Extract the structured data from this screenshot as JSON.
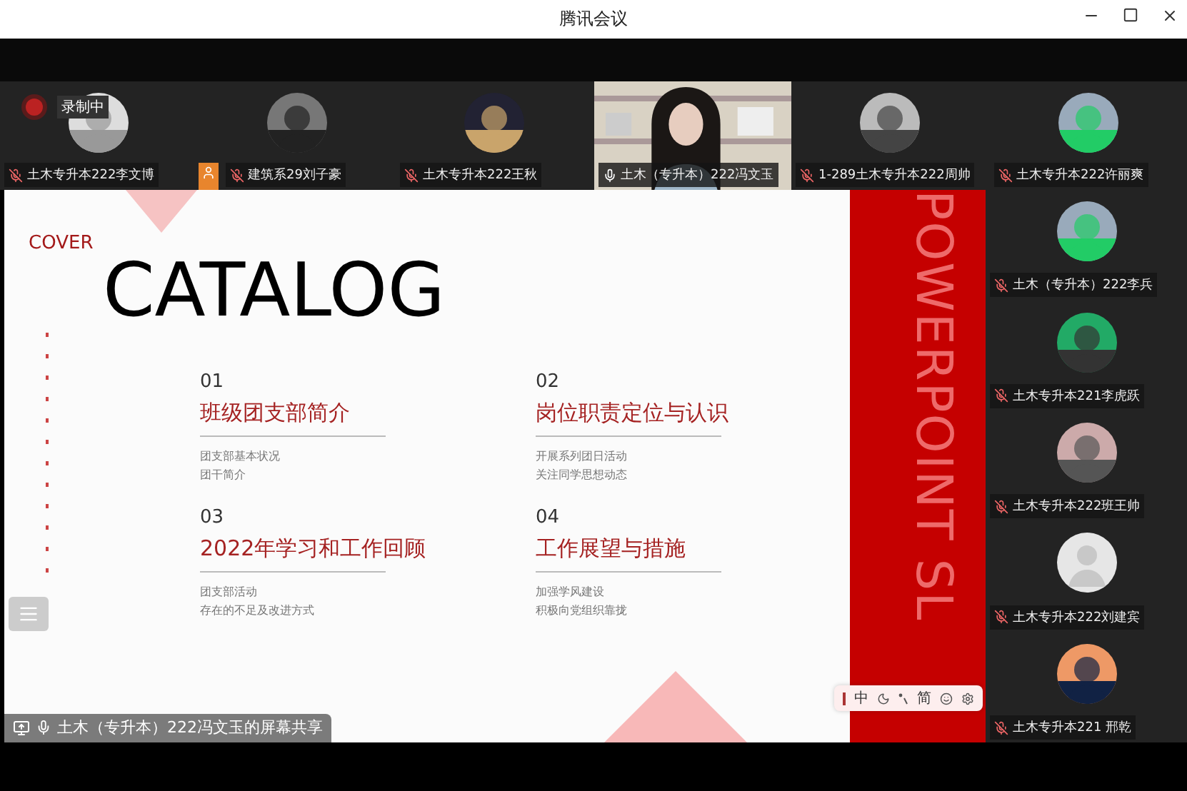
{
  "window": {
    "title": "腾讯会议"
  },
  "recording": {
    "label": "录制中"
  },
  "top_participants": [
    {
      "name": "土木专升本222李文博",
      "muted": true,
      "host": false
    },
    {
      "name": "建筑系29刘子豪",
      "muted": true,
      "host": true
    },
    {
      "name": "土木专升本222王秋",
      "muted": true,
      "host": false
    },
    {
      "name": "土木（专升本）222冯文玉",
      "kind": "video",
      "muted": false,
      "host": false
    },
    {
      "name": "1-289土木专升本222周帅",
      "muted": true,
      "host": false
    },
    {
      "name": "土木专升本222许丽爽",
      "muted": true,
      "host": false
    }
  ],
  "side_participants": [
    {
      "name": "土木（专升本）222李兵",
      "muted": true
    },
    {
      "name": "土木专升本221李虎跃",
      "muted": true
    },
    {
      "name": "土木专升本222班王帅",
      "muted": true
    },
    {
      "name": "土木专升本222刘建宾",
      "kind": "default",
      "muted": true
    },
    {
      "name": "土木专升本221 邢乾",
      "muted": true
    }
  ],
  "slide": {
    "kicker": "COVER",
    "title": "CATALOG",
    "band_text": "POWERPOINT SL",
    "sections": [
      {
        "number": "01",
        "heading": "班级团支部简介",
        "points": [
          "团支部基本状况",
          "团干简介"
        ]
      },
      {
        "number": "02",
        "heading": "岗位职责定位与认识",
        "points": [
          "开展系列团日活动",
          "关注同学思想动态"
        ]
      },
      {
        "number": "03",
        "heading": "2022年学习和工作回顾",
        "points": [
          "团支部活动",
          "存在的不足及改进方式"
        ]
      },
      {
        "number": "04",
        "heading": "工作展望与措施",
        "points": [
          "加强学风建设",
          "积极向党组织靠拢"
        ]
      }
    ]
  },
  "ime_toolbar": [
    {
      "kind": "cursor"
    },
    {
      "kind": "text",
      "label": "中"
    },
    {
      "kind": "moon"
    },
    {
      "kind": "punct"
    },
    {
      "kind": "text",
      "label": "简"
    },
    {
      "kind": "emoji"
    },
    {
      "kind": "settings"
    }
  ],
  "share_label": "土木（专升本）222冯文玉的屏幕共享"
}
